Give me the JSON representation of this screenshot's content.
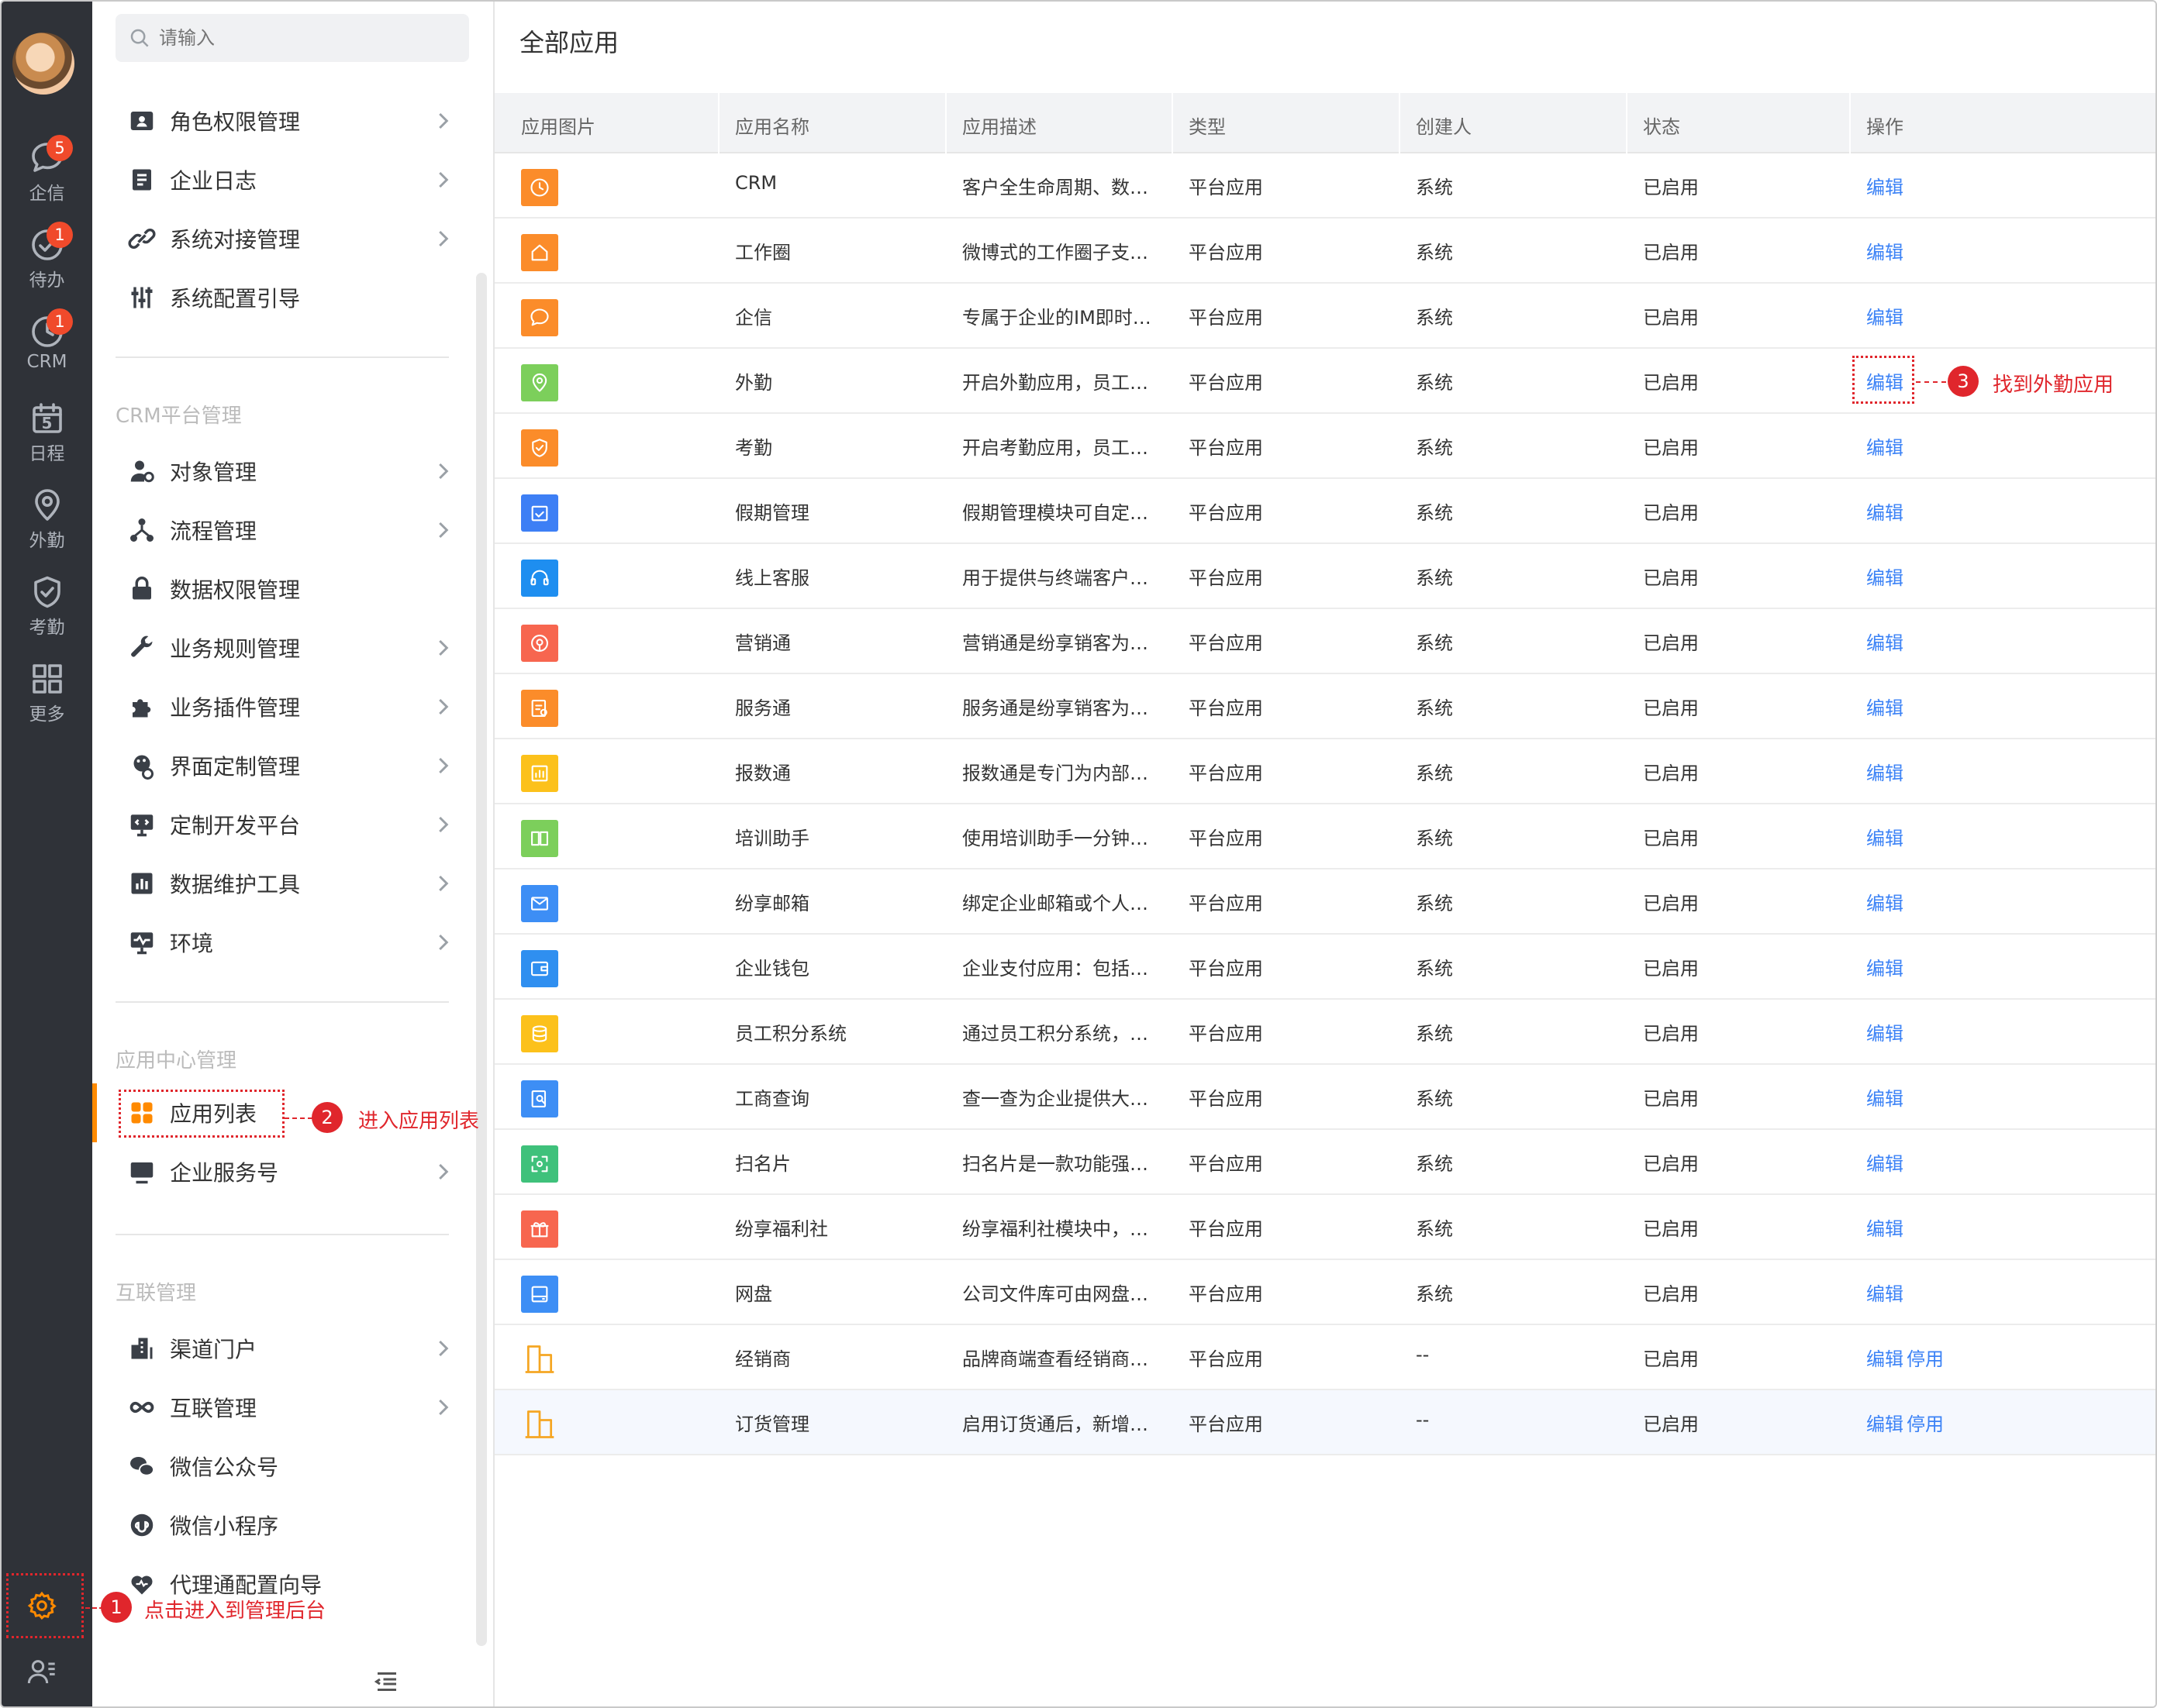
{
  "rail": {
    "items": [
      {
        "label": "企信",
        "icon": "chat-icon",
        "badge": "5"
      },
      {
        "label": "待办",
        "icon": "check-circle-icon",
        "badge": "1"
      },
      {
        "label": "CRM",
        "icon": "clock-icon",
        "badge": "1"
      },
      {
        "label": "日程",
        "icon": "calendar-icon",
        "day": "5"
      },
      {
        "label": "外勤",
        "icon": "location-pin-icon"
      },
      {
        "label": "考勤",
        "icon": "shield-check-icon"
      },
      {
        "label": "更多",
        "icon": "grid-icon"
      }
    ]
  },
  "sidebar": {
    "search_placeholder": "请输入",
    "group1": [
      {
        "label": "角色权限管理",
        "icon": "id-card-icon"
      },
      {
        "label": "企业日志",
        "icon": "log-icon"
      },
      {
        "label": "系统对接管理",
        "icon": "link-icon"
      },
      {
        "label": "系统配置引导",
        "icon": "sliders-icon"
      }
    ],
    "section_crm": "CRM平台管理",
    "group2": [
      {
        "label": "对象管理",
        "icon": "user-gear-icon"
      },
      {
        "label": "流程管理",
        "icon": "flow-icon"
      },
      {
        "label": "数据权限管理",
        "icon": "lock-icon"
      },
      {
        "label": "业务规则管理",
        "icon": "wrench-icon"
      },
      {
        "label": "业务插件管理",
        "icon": "puzzle-icon"
      },
      {
        "label": "界面定制管理",
        "icon": "palette-icon"
      },
      {
        "label": "定制开发平台",
        "icon": "code-monitor-icon"
      },
      {
        "label": "数据维护工具",
        "icon": "bar-chart-icon"
      },
      {
        "label": "环境",
        "icon": "pulse-monitor-icon"
      }
    ],
    "section_app": "应用中心管理",
    "group3": [
      {
        "label": "应用列表",
        "icon": "apps-icon"
      },
      {
        "label": "企业服务号",
        "icon": "monitor-icon"
      }
    ],
    "section_link": "互联管理",
    "group4": [
      {
        "label": "渠道门户",
        "icon": "building-icon"
      },
      {
        "label": "互联管理",
        "icon": "infinity-icon"
      },
      {
        "label": "微信公众号",
        "icon": "wechat-icon"
      },
      {
        "label": "微信小程序",
        "icon": "miniprogram-icon"
      },
      {
        "label": "代理通配置向导",
        "icon": "heart-icon"
      }
    ]
  },
  "main": {
    "title": "全部应用",
    "columns": [
      "应用图片",
      "应用名称",
      "应用描述",
      "类型",
      "创建人",
      "状态",
      "操作"
    ],
    "rows": [
      {
        "name": "CRM",
        "desc": "客户全生命周期、数…",
        "type": "平台应用",
        "creator": "系统",
        "status": "已启用",
        "ops": [
          "编辑"
        ],
        "color": "#fb8c2a",
        "icon": "clock-icon"
      },
      {
        "name": "工作圈",
        "desc": "微博式的工作圈子支…",
        "type": "平台应用",
        "creator": "系统",
        "status": "已启用",
        "ops": [
          "编辑"
        ],
        "color": "#fb8c2a",
        "icon": "home-icon"
      },
      {
        "name": "企信",
        "desc": "专属于企业的IM即时…",
        "type": "平台应用",
        "creator": "系统",
        "status": "已启用",
        "ops": [
          "编辑"
        ],
        "color": "#fb8c2a",
        "icon": "chat-icon"
      },
      {
        "name": "外勤",
        "desc": "开启外勤应用，员工…",
        "type": "平台应用",
        "creator": "系统",
        "status": "已启用",
        "ops": [
          "编辑"
        ],
        "color": "#7ccf5b",
        "icon": "location-pin-icon"
      },
      {
        "name": "考勤",
        "desc": "开启考勤应用，员工…",
        "type": "平台应用",
        "creator": "系统",
        "status": "已启用",
        "ops": [
          "编辑"
        ],
        "color": "#fb8c2a",
        "icon": "shield-check-icon"
      },
      {
        "name": "假期管理",
        "desc": "假期管理模块可自定…",
        "type": "平台应用",
        "creator": "系统",
        "status": "已启用",
        "ops": [
          "编辑"
        ],
        "color": "#3d7ff5",
        "icon": "calendar-check-icon"
      },
      {
        "name": "线上客服",
        "desc": "用于提供与终端客户…",
        "type": "平台应用",
        "creator": "系统",
        "status": "已启用",
        "ops": [
          "编辑"
        ],
        "color": "#1e8ef0",
        "icon": "headset-icon"
      },
      {
        "name": "营销通",
        "desc": "营销通是纷享销客为…",
        "type": "平台应用",
        "creator": "系统",
        "status": "已启用",
        "ops": [
          "编辑"
        ],
        "color": "#f7664f",
        "icon": "broadcast-icon"
      },
      {
        "name": "服务通",
        "desc": "服务通是纷享销客为…",
        "type": "平台应用",
        "creator": "系统",
        "status": "已启用",
        "ops": [
          "编辑"
        ],
        "color": "#fb8c2a",
        "icon": "service-icon"
      },
      {
        "name": "报数通",
        "desc": "报数通是专门为内部…",
        "type": "平台应用",
        "creator": "系统",
        "status": "已启用",
        "ops": [
          "编辑"
        ],
        "color": "#fcc11b",
        "icon": "report-icon"
      },
      {
        "name": "培训助手",
        "desc": "使用培训助手一分钟…",
        "type": "平台应用",
        "creator": "系统",
        "status": "已启用",
        "ops": [
          "编辑"
        ],
        "color": "#7ccf5b",
        "icon": "book-icon"
      },
      {
        "name": "纷享邮箱",
        "desc": "绑定企业邮箱或个人…",
        "type": "平台应用",
        "creator": "系统",
        "status": "已启用",
        "ops": [
          "编辑"
        ],
        "color": "#3d8ef5",
        "icon": "mail-icon"
      },
      {
        "name": "企业钱包",
        "desc": "企业支付应用：包括…",
        "type": "平台应用",
        "creator": "系统",
        "status": "已启用",
        "ops": [
          "编辑"
        ],
        "color": "#2f8ff0",
        "icon": "wallet-icon"
      },
      {
        "name": "员工积分系统",
        "desc": "通过员工积分系统，…",
        "type": "平台应用",
        "creator": "系统",
        "status": "已启用",
        "ops": [
          "编辑"
        ],
        "color": "#fcc11b",
        "icon": "coins-icon"
      },
      {
        "name": "工商查询",
        "desc": "查一查为企业提供大…",
        "type": "平台应用",
        "creator": "系统",
        "status": "已启用",
        "ops": [
          "编辑"
        ],
        "color": "#3d8ef5",
        "icon": "search-doc-icon"
      },
      {
        "name": "扫名片",
        "desc": "扫名片是一款功能强…",
        "type": "平台应用",
        "creator": "系统",
        "status": "已启用",
        "ops": [
          "编辑"
        ],
        "color": "#3fc17b",
        "icon": "scan-icon"
      },
      {
        "name": "纷享福利社",
        "desc": "纷享福利社模块中，…",
        "type": "平台应用",
        "creator": "系统",
        "status": "已启用",
        "ops": [
          "编辑"
        ],
        "color": "#f7664f",
        "icon": "gift-icon"
      },
      {
        "name": "网盘",
        "desc": "公司文件库可由网盘…",
        "type": "平台应用",
        "creator": "系统",
        "status": "已启用",
        "ops": [
          "编辑"
        ],
        "color": "#3d8ef5",
        "icon": "disk-icon"
      },
      {
        "name": "经销商",
        "desc": "品牌商端查看经销商…",
        "type": "平台应用",
        "creator": "--",
        "status": "已启用",
        "ops": [
          "编辑",
          "停用"
        ],
        "color": "#f5a623",
        "icon": "building-outline-icon"
      },
      {
        "name": "订货管理",
        "desc": "启用订货通后，新增…",
        "type": "平台应用",
        "creator": "--",
        "status": "已启用",
        "ops": [
          "编辑",
          "停用"
        ],
        "color": "#f5a623",
        "icon": "building-outline-icon"
      }
    ]
  },
  "callouts": {
    "c1_num": "1",
    "c1_text": "点击进入到管理后台",
    "c2_num": "2",
    "c2_text": "进入应用列表",
    "c3_num": "3",
    "c3_text": "找到外勤应用"
  },
  "colors": {
    "rail_bg": "#2f3238",
    "accent": "#ff8a00",
    "link": "#3b82f6",
    "annotation": "#e0262c",
    "badge": "#f04a2b"
  }
}
